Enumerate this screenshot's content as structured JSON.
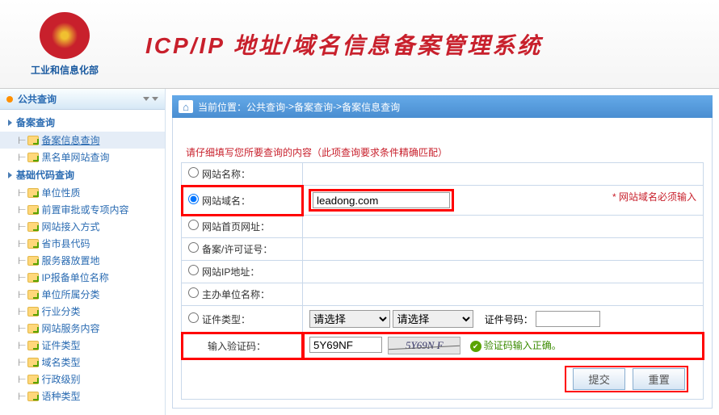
{
  "header": {
    "ministry": "工业和信息化部",
    "title": "ICP/IP 地址/域名信息备案管理系统"
  },
  "sidebar": {
    "title": "公共查询",
    "groups": [
      {
        "label": "备案查询",
        "items": [
          {
            "label": "备案信息查询",
            "active": true
          },
          {
            "label": "黑名单网站查询",
            "active": false
          }
        ]
      },
      {
        "label": "基础代码查询",
        "items": [
          {
            "label": "单位性质"
          },
          {
            "label": "前置审批或专项内容"
          },
          {
            "label": "网站接入方式"
          },
          {
            "label": "省市县代码"
          },
          {
            "label": "服务器放置地"
          },
          {
            "label": "IP报备单位名称"
          },
          {
            "label": "单位所属分类"
          },
          {
            "label": "行业分类"
          },
          {
            "label": "网站服务内容"
          },
          {
            "label": "证件类型"
          },
          {
            "label": "域名类型"
          },
          {
            "label": "行政级别"
          },
          {
            "label": "语种类型"
          }
        ]
      }
    ]
  },
  "breadcrumb": {
    "prefix": "当前位置：",
    "parts": [
      "公共查询",
      "备案查询",
      "备案信息查询"
    ],
    "sep": " -> "
  },
  "form": {
    "instruction": "请仔细填写您所要查询的内容（此项查询要求条件精确匹配）",
    "rows": {
      "r0": {
        "label": "网站名称："
      },
      "r1": {
        "label": "网站域名：",
        "value": "leadong.com",
        "note": "* 网站域名必须输入"
      },
      "r2": {
        "label": "网站首页网址："
      },
      "r3": {
        "label": "备案/许可证号："
      },
      "r4": {
        "label": "网站IP地址："
      },
      "r5": {
        "label": "主办单位名称："
      },
      "r6": {
        "label": "证件类型：",
        "sel1": "请选择",
        "sel2": "请选择",
        "cert_label": "证件号码："
      },
      "r7": {
        "label": "输入验证码：",
        "value": "5Y69NF",
        "captcha_text": "5Y69N F",
        "valid": "验证码输入正确。"
      }
    },
    "submit": "提交",
    "reset": "重置"
  }
}
